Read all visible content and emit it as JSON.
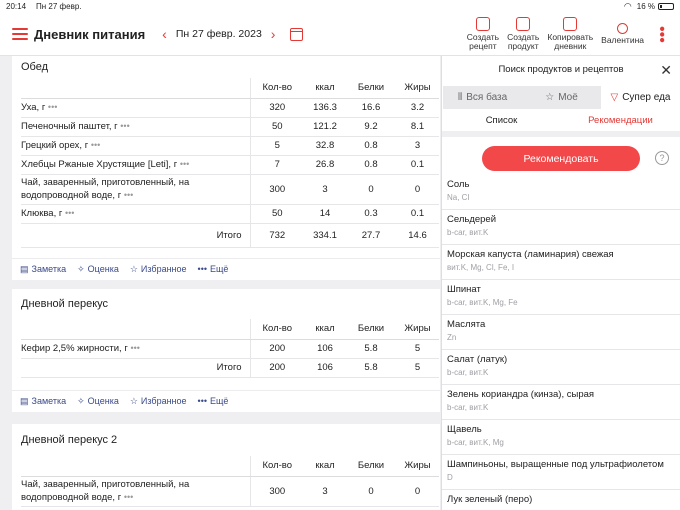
{
  "status": {
    "time": "20:14",
    "date": "Пн 27 февр.",
    "battery": "16 %"
  },
  "header": {
    "title": "Дневник питания",
    "date": "Пн 27 февр. 2023",
    "buttons": [
      {
        "label1": "Создать",
        "label2": "рецепт",
        "icon": "recipe-icon"
      },
      {
        "label1": "Создать",
        "label2": "продукт",
        "icon": "product-icon"
      },
      {
        "label1": "Копировать",
        "label2": "дневник",
        "icon": "copy-icon"
      },
      {
        "label1": "Валентина",
        "label2": "",
        "icon": "user-icon"
      }
    ]
  },
  "columns": {
    "qty": "Кол-во",
    "kcal": "ккал",
    "protein": "Белки",
    "fat": "Жиры"
  },
  "meals": [
    {
      "title": "Обед",
      "rows": [
        {
          "name": "Уха, г",
          "qty": "320",
          "kcal": "136.3",
          "protein": "16.6",
          "fat": "3.2"
        },
        {
          "name": "Печеночный паштет, г",
          "qty": "50",
          "kcal": "121.2",
          "protein": "9.2",
          "fat": "8.1"
        },
        {
          "name": "Грецкий орех, г",
          "qty": "5",
          "kcal": "32.8",
          "protein": "0.8",
          "fat": "3"
        },
        {
          "name": "Хлебцы Ржаные Хрустящие [Leti], г",
          "qty": "7",
          "kcal": "26.8",
          "protein": "0.8",
          "fat": "0.1"
        },
        {
          "name": "Чай, заваренный, приготовленный, на водопроводной воде, г",
          "qty": "300",
          "kcal": "3",
          "protein": "0",
          "fat": "0"
        },
        {
          "name": "Клюква, г",
          "qty": "50",
          "kcal": "14",
          "protein": "0.3",
          "fat": "0.1"
        }
      ],
      "total": {
        "label": "Итого",
        "qty": "732",
        "kcal": "334.1",
        "protein": "27.7",
        "fat": "14.6"
      }
    },
    {
      "title": "Дневной перекус",
      "rows": [
        {
          "name": "Кефир 2,5% жирности, г",
          "qty": "200",
          "kcal": "106",
          "protein": "5.8",
          "fat": "5"
        }
      ],
      "total": {
        "label": "Итого",
        "qty": "200",
        "kcal": "106",
        "protein": "5.8",
        "fat": "5"
      }
    },
    {
      "title": "Дневной перекус 2",
      "rows": [
        {
          "name": "Чай, заваренный, приготовленный, на водопроводной воде, г",
          "qty": "300",
          "kcal": "3",
          "protein": "0",
          "fat": "0"
        }
      ]
    }
  ],
  "actions": {
    "note": "Заметка",
    "rating": "Оценка",
    "favorite": "Избранное",
    "more": "Ещё"
  },
  "panel": {
    "title": "Поиск продуктов и рецептов",
    "tabs": [
      "Вся база",
      "Моё",
      "Супер еда"
    ],
    "subtabs": [
      "Список",
      "Рекомендации"
    ],
    "recommend_button": "Рекомендовать",
    "products": [
      {
        "name": "Соль",
        "tags": "Na, Cl"
      },
      {
        "name": "Сельдерей",
        "tags": "b-car, вит.K"
      },
      {
        "name": "Морская капуста (ламинария) свежая",
        "tags": "вит.K, Mg, Cl, Fe, I"
      },
      {
        "name": "Шпинат",
        "tags": "b-car, вит.K, Mg, Fe"
      },
      {
        "name": "Маслята",
        "tags": "Zn"
      },
      {
        "name": "Салат (латук)",
        "tags": "b-car, вит.K"
      },
      {
        "name": "Зелень кориандра (кинза), сырая",
        "tags": "b-car, вит.K"
      },
      {
        "name": "Щавель",
        "tags": "b-car, вит.K, Mg"
      },
      {
        "name": "Шампиньоны, выращенные под ультрафиолетом",
        "tags": "D"
      },
      {
        "name": "Лук зеленый (перо)",
        "tags": ""
      }
    ]
  },
  "colors": {
    "accent": "#e53935",
    "link": "#3a4a8a"
  }
}
